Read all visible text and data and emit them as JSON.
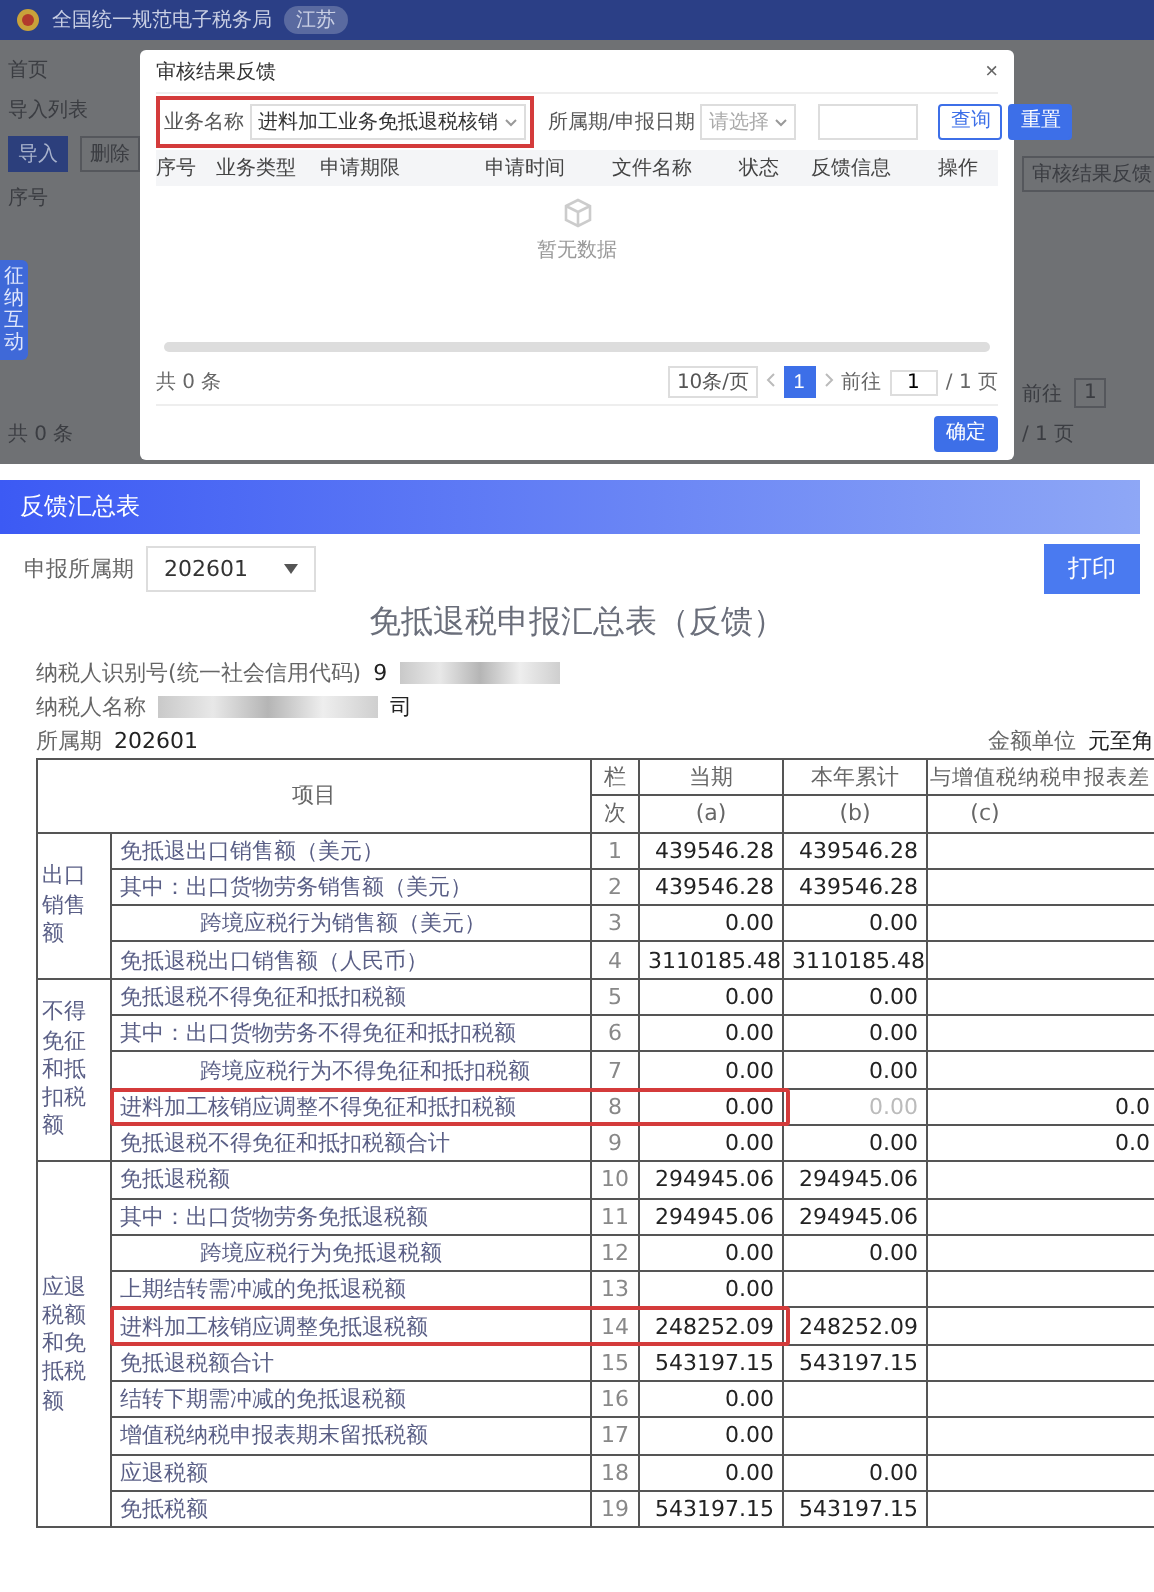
{
  "background_app": {
    "header": {
      "title": "全国统一规范电子税务局",
      "region": "江苏"
    },
    "breadcrumb": "首页",
    "tab": "导入列表",
    "buttons": [
      "导入",
      "删除"
    ],
    "column": "序号",
    "side_tab": "征纳互动",
    "right_button": "审核结果反馈",
    "total": "共 0 条",
    "goto_label": "前往",
    "goto_value": "1",
    "page_count": "/ 1 页"
  },
  "dialog": {
    "title": "审核结果反馈",
    "close": "×",
    "filters": [
      {
        "kind": "select",
        "label": "业务名称",
        "value": "进料加工业务免抵退税核销",
        "highlighted": true
      },
      {
        "kind": "select",
        "label": "所属期/申报日期",
        "placeholder": "请选择",
        "highlighted": false
      },
      {
        "kind": "input",
        "highlighted": false
      }
    ],
    "buttons": [
      {
        "label": "查询",
        "primary": false
      },
      {
        "label": "重置",
        "primary": true
      }
    ],
    "columns": [
      "序号",
      "业务类型",
      "申请期限",
      "申请时间",
      "文件名称",
      "状态",
      "反馈信息",
      "操作"
    ],
    "empty_text": "暂无数据",
    "pagination": {
      "total": "共 0 条",
      "page_size": "10条/页",
      "pages": [
        {
          "label": "1",
          "selected": true
        }
      ],
      "goto_label": "前往",
      "goto_value": "1",
      "page_count": "/ 1 页"
    },
    "confirm": "确定"
  },
  "report": {
    "header": "反馈汇总表",
    "period_label": "申报所属期",
    "period_value": "202601",
    "print": "打印",
    "title": "免抵退税申报汇总表（反馈）",
    "taxpayer_id_label": "纳税人识别号(统一社会信用代码)",
    "taxpayer_id_value": "9",
    "taxpayer_name_label": "纳税人名称",
    "taxpayer_name_suffix": "司",
    "period_row_label": "所属期",
    "period_row_value": "202601",
    "unit_label": "金额单位",
    "unit_value": "元至角",
    "columns": {
      "item": "项目",
      "line_top": "栏",
      "line_bottom": "次",
      "current": "当期",
      "current_code": "(a)",
      "ytd": "本年累计",
      "ytd_code": "(b)",
      "diff": "与增值税纳税申报表差",
      "diff_code": "(c)"
    },
    "groups": [
      {
        "label": "出口销售额",
        "rows": [
          {
            "item": "免抵退出口销售额（美元）",
            "line": "1",
            "current": "439546.28",
            "ytd": "439546.28",
            "indent": false,
            "highlighted": false,
            "ytd_disabled": false
          },
          {
            "item": "其中：出口货物劳务销售额（美元）",
            "line": "2",
            "current": "439546.28",
            "ytd": "439546.28",
            "indent": false,
            "highlighted": false,
            "ytd_disabled": false
          },
          {
            "item": "跨境应税行为销售额（美元）",
            "line": "3",
            "current": "0.00",
            "ytd": "0.00",
            "indent": true,
            "highlighted": false,
            "ytd_disabled": false
          },
          {
            "item": "免抵退税出口销售额（人民币）",
            "line": "4",
            "current": "3110185.48",
            "ytd": "3110185.48",
            "indent": false,
            "highlighted": false,
            "ytd_disabled": false
          }
        ]
      },
      {
        "label": "不得免征和抵扣税额",
        "rows": [
          {
            "item": "免抵退税不得免征和抵扣税额",
            "line": "5",
            "current": "0.00",
            "ytd": "0.00",
            "indent": false,
            "highlighted": false,
            "ytd_disabled": false
          },
          {
            "item": "其中：出口货物劳务不得免征和抵扣税额",
            "line": "6",
            "current": "0.00",
            "ytd": "0.00",
            "indent": false,
            "highlighted": false,
            "ytd_disabled": false
          },
          {
            "item": "跨境应税行为不得免征和抵扣税额",
            "line": "7",
            "current": "0.00",
            "ytd": "0.00",
            "indent": true,
            "highlighted": false,
            "ytd_disabled": false
          },
          {
            "item": "进料加工核销应调整不得免征和抵扣税额",
            "line": "8",
            "current": "0.00",
            "ytd": "0.00",
            "diff": "0.0",
            "indent": false,
            "highlighted": true,
            "ytd_disabled": true
          },
          {
            "item": "免抵退税不得免征和抵扣税额合计",
            "line": "9",
            "current": "0.00",
            "ytd": "0.00",
            "diff": "0.0",
            "indent": false,
            "highlighted": false,
            "ytd_disabled": false
          }
        ]
      },
      {
        "label": "应退税额和免抵税额",
        "rows": [
          {
            "item": "免抵退税额",
            "line": "10",
            "current": "294945.06",
            "ytd": "294945.06",
            "indent": false,
            "highlighted": false,
            "ytd_disabled": false
          },
          {
            "item": "其中：出口货物劳务免抵退税额",
            "line": "11",
            "current": "294945.06",
            "ytd": "294945.06",
            "indent": false,
            "highlighted": false,
            "ytd_disabled": false
          },
          {
            "item": "跨境应税行为免抵退税额",
            "line": "12",
            "current": "0.00",
            "ytd": "0.00",
            "indent": true,
            "highlighted": false,
            "ytd_disabled": false
          },
          {
            "item": "上期结转需冲减的免抵退税额",
            "line": "13",
            "current": "0.00",
            "indent": false,
            "highlighted": false
          },
          {
            "item": "进料加工核销应调整免抵退税额",
            "line": "14",
            "current": "248252.09",
            "ytd": "248252.09",
            "indent": false,
            "highlighted": true,
            "ytd_disabled": false
          },
          {
            "item": "免抵退税额合计",
            "line": "15",
            "current": "543197.15",
            "ytd": "543197.15",
            "indent": false,
            "highlighted": false,
            "ytd_disabled": false
          },
          {
            "item": "结转下期需冲减的免抵退税额",
            "line": "16",
            "current": "0.00",
            "indent": false,
            "highlighted": false
          },
          {
            "item": "增值税纳税申报表期末留抵税额",
            "line": "17",
            "current": "0.00",
            "indent": false,
            "highlighted": false
          },
          {
            "item": "应退税额",
            "line": "18",
            "current": "0.00",
            "ytd": "0.00",
            "indent": false,
            "highlighted": false,
            "ytd_disabled": false
          },
          {
            "item": "免抵税额",
            "line": "19",
            "current": "543197.15",
            "ytd": "543197.15",
            "indent": false,
            "highlighted": false,
            "ytd_disabled": false
          }
        ]
      }
    ]
  }
}
